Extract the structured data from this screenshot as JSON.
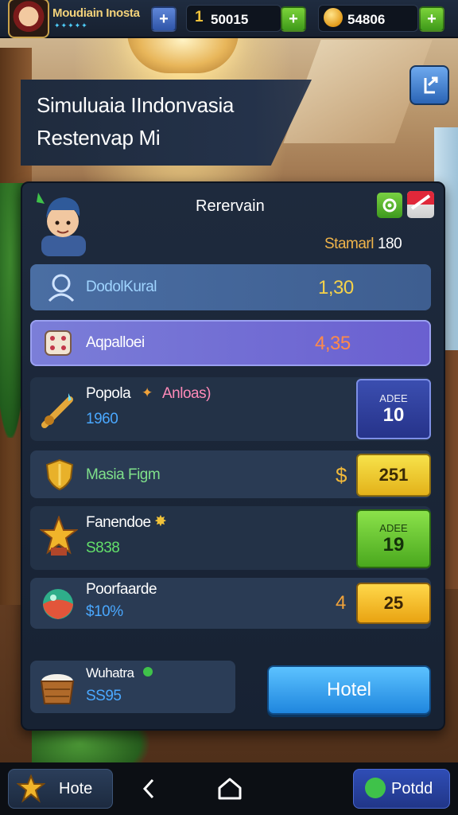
{
  "topbar": {
    "player_name": "Moudiain Inosta",
    "player_stars": "✦✦✦✦✦",
    "resource1_icon": "1",
    "resource1_value": "50015",
    "resource2_value": "54806",
    "plus": "+"
  },
  "title": {
    "line1": "Simuluaia IIndonvasia",
    "line2": "Restenvap Mi"
  },
  "panel": {
    "title": "Rerervain",
    "status_label": "Stamarl",
    "status_value": "180"
  },
  "rows": [
    {
      "label": "DodolKural",
      "value": "1,30",
      "label_color": "#9fd4ff",
      "value_color": "#f5d24a"
    },
    {
      "label": "Aqpalloei",
      "value": "4,35",
      "label_color": "#ffffff",
      "value_color": "#ff8a4a"
    },
    {
      "label": "Popola",
      "tag": "Anloas)",
      "sub": "1960",
      "box_head": "ADEE",
      "box_value": "10",
      "sub_color": "#4aa8ff"
    },
    {
      "label": "Masia Figm",
      "currency": "$",
      "box_value": "251",
      "label_color": "#7fe08a"
    },
    {
      "label": "Fanendoe",
      "sub": "S838",
      "box_head": "ADEE",
      "box_value": "19",
      "sub_color": "#63e06a"
    },
    {
      "label": "Poorfaarde",
      "sub": "$10%",
      "currency": "4",
      "box_value": "25",
      "sub_color": "#4aa8ff"
    }
  ],
  "bottom_card": {
    "label": "Wuhatra",
    "value": "SS95"
  },
  "hotel_button": "Hotel",
  "navbar": {
    "left_label": "Hote",
    "right_label": "Potdd"
  },
  "icons": {
    "title_exit": "exit-icon",
    "gear": "gear-icon",
    "flag": "flag-icon",
    "back": "chevron-left-icon",
    "home": "home-icon"
  }
}
